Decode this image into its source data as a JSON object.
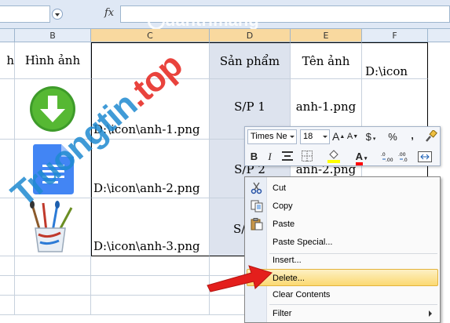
{
  "formula_bar": {
    "fx": "fx",
    "value": ""
  },
  "columns": [
    {
      "letter": "B"
    },
    {
      "letter": "C"
    },
    {
      "letter": "D"
    },
    {
      "letter": "E"
    },
    {
      "letter": "F"
    }
  ],
  "headers": {
    "col_a": "h",
    "col_b": "Hình ảnh",
    "col_d": "Sản phẩm",
    "col_e": "Tên ảnh",
    "col_f": "D:\\icon"
  },
  "rows": [
    {
      "path": "D:\\icon\\anh-1.png",
      "product": "S/P 1",
      "image_name": "anh-1.png",
      "icon": "download-arrow-icon"
    },
    {
      "path": "D:\\icon\\anh-2.png",
      "product": "S/P 2",
      "image_name": "anh-2.png",
      "icon": "google-docs-icon"
    },
    {
      "path": "D:\\icon\\anh-3.png",
      "product": "S/",
      "image_name": "",
      "icon": "paint-brushes-cup-icon"
    }
  ],
  "mini_toolbar": {
    "font_name": "Times Ne",
    "font_size": "18",
    "grow_font": "A",
    "shrink_font": "A",
    "currency": "$",
    "percent": "%",
    "comma": ",",
    "bold": "B",
    "italic": "I",
    "font_color_letter": "A",
    "fill_color": "#ffff00",
    "font_color": "#ff0000"
  },
  "context_menu": {
    "items": [
      {
        "label": "Cut",
        "icon": "scissors-icon"
      },
      {
        "label": "Copy",
        "icon": "copy-icon"
      },
      {
        "label": "Paste",
        "icon": "paste-icon"
      },
      {
        "label": "Paste Special...",
        "icon": ""
      },
      {
        "label": "Insert...",
        "icon": ""
      },
      {
        "label": "Delete...",
        "icon": "",
        "highlighted": true
      },
      {
        "label": "Clear Contents",
        "icon": ""
      },
      {
        "label": "Filter",
        "icon": "",
        "submenu": true
      }
    ]
  },
  "watermark": {
    "part1": "Truong",
    "part2": "tin",
    "part3": ".top",
    "logo": "uantrimang"
  }
}
